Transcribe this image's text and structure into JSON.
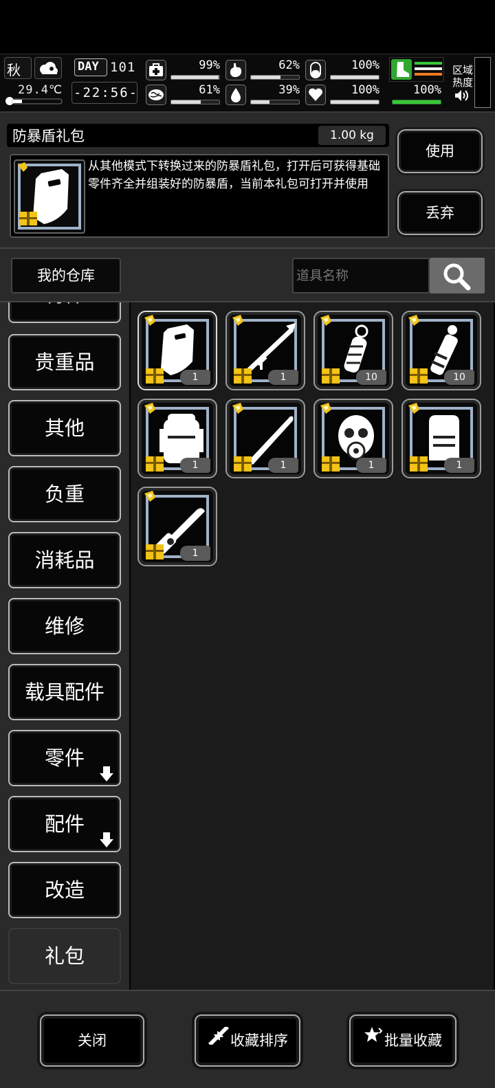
{
  "status": {
    "season": "秋",
    "temperature": "29.4℃",
    "day_label": "DAY",
    "day_number": "101",
    "clock": "-22:56-",
    "stats": [
      {
        "icon": "medkit-icon",
        "value": "99%",
        "fill": 0.99
      },
      {
        "icon": "stomach-icon",
        "value": "62%",
        "fill": 0.62
      },
      {
        "icon": "pill-icon",
        "value": "100%",
        "fill": 1.0
      },
      {
        "icon": "brain-icon",
        "value": "61%",
        "fill": 0.61
      },
      {
        "icon": "water-drop-icon",
        "value": "39%",
        "fill": 0.39
      },
      {
        "icon": "heart-icon",
        "value": "100%",
        "fill": 1.0
      }
    ],
    "stamina": {
      "value": "100%",
      "fill": 1.0
    },
    "zone_heat_label_1": "区域",
    "zone_heat_label_2": "热度"
  },
  "detail": {
    "item_name": "防暴盾礼包",
    "weight": "1.00 kg",
    "description": "从其他模式下转换过来的防暴盾礼包，打开后可获得基础零件齐全并组装好的防暴盾，当前本礼包可打开并使用",
    "use_label": "使用",
    "discard_label": "丢弃"
  },
  "warehouse": {
    "title": "我的仓库",
    "search_placeholder": "道具名称"
  },
  "categories": [
    {
      "label": "特件"
    },
    {
      "label": "贵重品"
    },
    {
      "label": "其他"
    },
    {
      "label": "负重"
    },
    {
      "label": "消耗品"
    },
    {
      "label": "维修"
    },
    {
      "label": "载具配件"
    },
    {
      "label": "零件",
      "expand": true
    },
    {
      "label": "配件",
      "expand": true
    },
    {
      "label": "改造"
    },
    {
      "label": "礼包",
      "active": true
    }
  ],
  "items": [
    {
      "icon": "riot-shield-icon",
      "count": "1",
      "selected": true
    },
    {
      "icon": "rocket-launcher-icon",
      "count": "1"
    },
    {
      "icon": "grenade-icon",
      "count": "10"
    },
    {
      "icon": "flashbang-icon",
      "count": "10"
    },
    {
      "icon": "backpack-icon",
      "count": "1"
    },
    {
      "icon": "machete-icon",
      "count": "1"
    },
    {
      "icon": "gas-mask-icon",
      "count": "1"
    },
    {
      "icon": "body-armor-icon",
      "count": "1"
    },
    {
      "icon": "chainsaw-icon",
      "count": "1"
    }
  ],
  "bottom": {
    "close_label": "关闭",
    "sort_label": "收藏排序",
    "batch_label": "批量收藏"
  },
  "colors": {
    "accent_green": "#38c838",
    "gift_gold": "#f2c418",
    "frame_blue": "#9fb3c8"
  }
}
